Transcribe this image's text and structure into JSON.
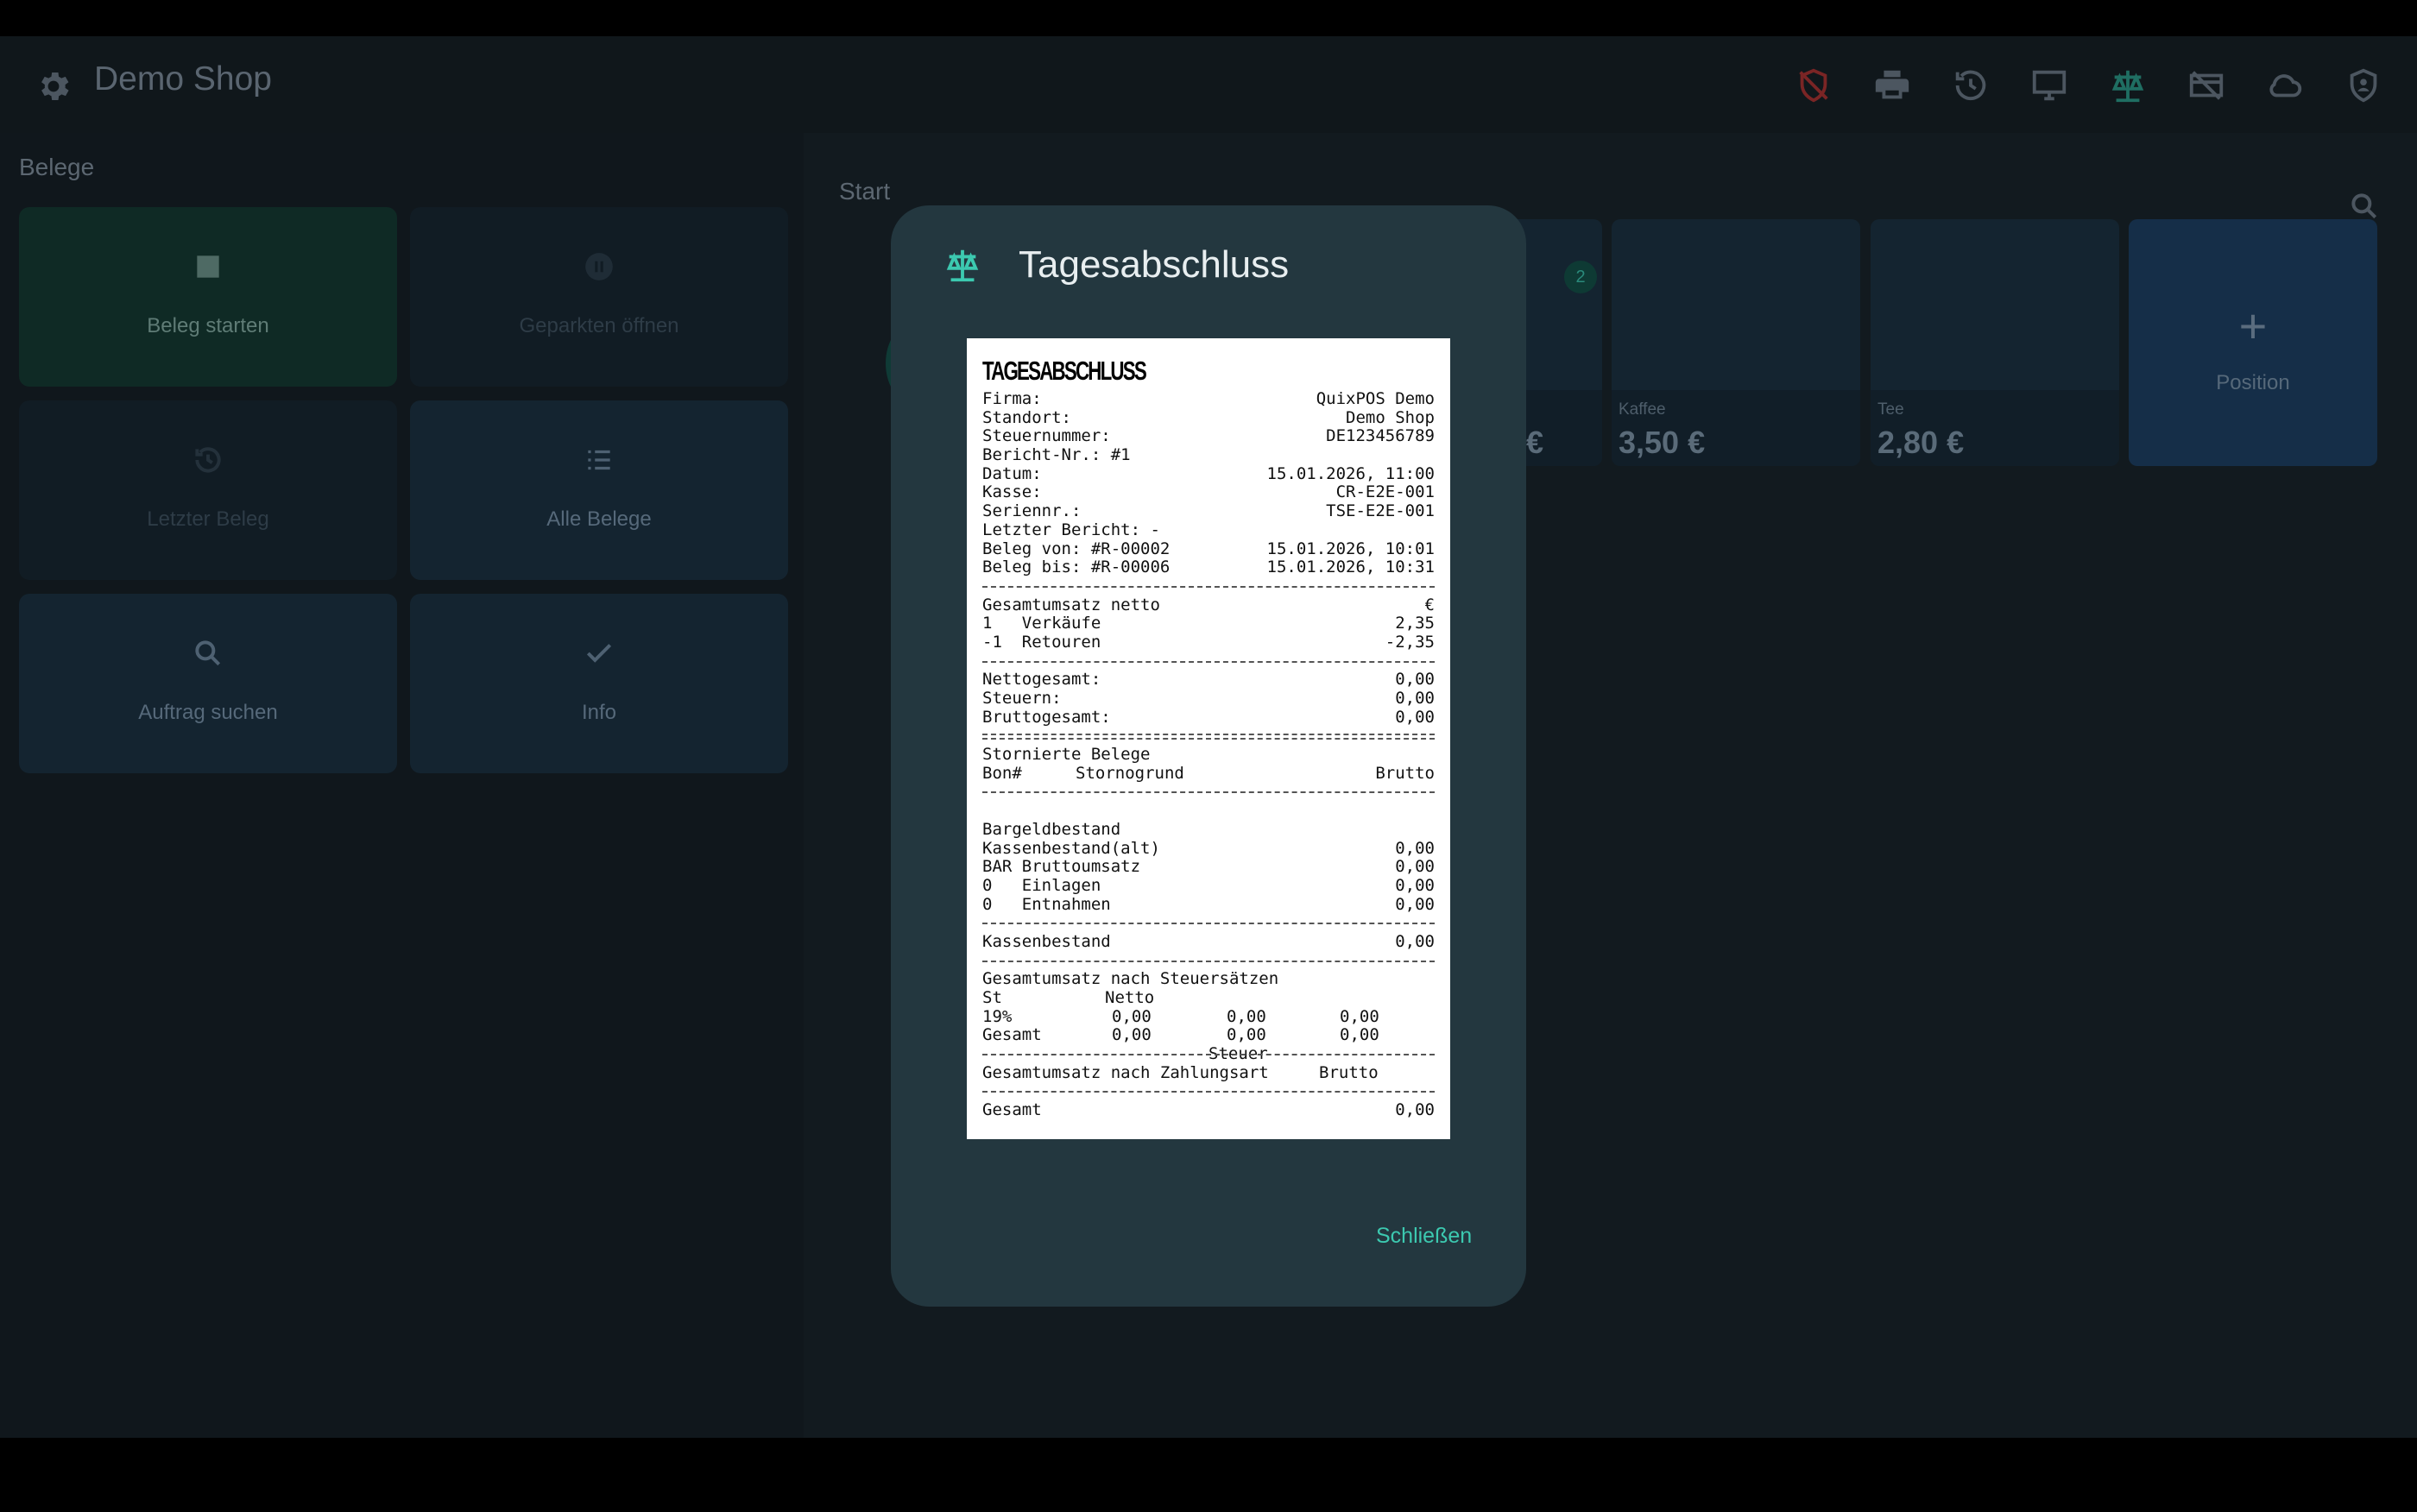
{
  "app": {
    "title": "Demo Shop",
    "accent": "#3cc9b0"
  },
  "toolbar": {
    "icons": [
      "shield-off-icon",
      "printer-icon",
      "history-icon",
      "monitor-icon",
      "scale-icon",
      "card-off-icon",
      "cloud-icon",
      "shield-user-icon"
    ]
  },
  "left_panel": {
    "title": "Belege",
    "tiles": [
      {
        "label": "Beleg starten",
        "icon": "stop-icon"
      },
      {
        "label": "Geparkten öffnen",
        "icon": "pause-icon"
      },
      {
        "label": "Letzter Beleg",
        "icon": "history-icon"
      },
      {
        "label": "Alle Belege",
        "icon": "list-icon"
      },
      {
        "label": "Auftrag suchen",
        "icon": "search-icon"
      },
      {
        "label": "Info",
        "icon": "check-icon"
      }
    ]
  },
  "right_panel": {
    "title": "Start",
    "badge": "2",
    "products": [
      {
        "name": "",
        "price": "€"
      },
      {
        "name": "Kaffee",
        "price": "3,50 €"
      },
      {
        "name": "Tee",
        "price": "2,80 €"
      }
    ],
    "add_label": "Position"
  },
  "dialog": {
    "title": "Tagesabschluss",
    "close_label": "Schließen",
    "receipt": {
      "title": "TAGESABSCHLUSS",
      "header": [
        [
          "Firma:",
          "QuixPOS Demo"
        ],
        [
          "Standort:",
          "Demo Shop"
        ],
        [
          "Steuernummer:",
          "DE123456789"
        ],
        [
          "Bericht-Nr.: #1",
          ""
        ],
        [
          "Datum:",
          "15.01.2026, 11:00"
        ],
        [
          "Kasse:",
          "CR-E2E-001"
        ],
        [
          "Seriennr.:",
          "TSE-E2E-001"
        ],
        [
          "Letzter Bericht: -",
          ""
        ],
        [
          "Beleg von: #R-00002",
          "15.01.2026, 10:01"
        ],
        [
          "Beleg bis: #R-00006",
          "15.01.2026, 10:31"
        ]
      ],
      "umsatz": [
        [
          "Gesamtumsatz netto",
          "€"
        ],
        [
          "1   Verkäufe",
          "2,35"
        ],
        [
          "-1  Retouren",
          "-2,35"
        ]
      ],
      "totals": [
        [
          "Nettogesamt:",
          "0,00"
        ],
        [
          "Steuern:",
          "0,00"
        ],
        [
          "Bruttogesamt:",
          "0,00"
        ]
      ],
      "storno_title": "Stornierte Belege",
      "storno_header": {
        "bon": "Bon#",
        "grund": "Stornogrund",
        "brutto": "Brutto"
      },
      "bargeld": [
        [
          "Bargeldbestand",
          ""
        ],
        [
          "Kassenbestand(alt)",
          "0,00"
        ],
        [
          "BAR Bruttoumsatz",
          "0,00"
        ],
        [
          "0   Einlagen",
          "0,00"
        ],
        [
          "0   Entnahmen",
          "0,00"
        ]
      ],
      "kassenbestand": [
        "Kassenbestand",
        "0,00"
      ],
      "steuersatz_title": "Gesamtumsatz nach Steuersätzen",
      "steuersatz_header": [
        "St",
        "Netto",
        "Steuer",
        "Brutto"
      ],
      "steuersatz_rows": [
        [
          "19%",
          "0,00",
          "0,00",
          "0,00"
        ],
        [
          "Gesamt",
          "0,00",
          "0,00",
          "0,00"
        ]
      ],
      "zahlungsart_title": "Gesamtumsatz nach Zahlungsart",
      "gesamt": [
        "Gesamt",
        "0,00"
      ]
    }
  }
}
